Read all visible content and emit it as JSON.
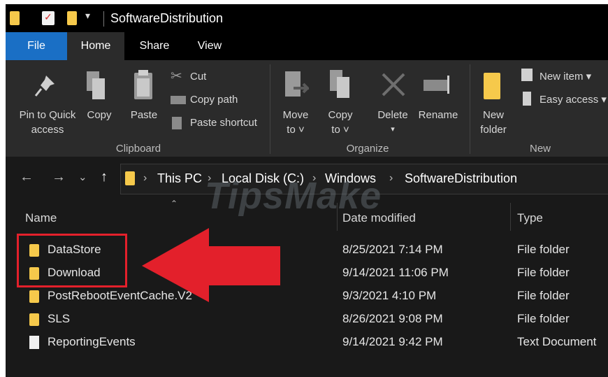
{
  "window": {
    "title": "SoftwareDistribution"
  },
  "tabs": [
    "File",
    "Home",
    "Share",
    "View"
  ],
  "ribbon": {
    "clipboard": {
      "pin_line1": "Pin to Quick",
      "pin_line2": "access",
      "copy": "Copy",
      "paste": "Paste",
      "cut": "Cut",
      "copy_path": "Copy path",
      "paste_shortcut": "Paste shortcut",
      "group": "Clipboard"
    },
    "organize": {
      "move_line1": "Move",
      "move_line2": "to ˅",
      "copy_line1": "Copy",
      "copy_line2": "to ˅",
      "delete": "Delete",
      "rename": "Rename",
      "group": "Organize"
    },
    "new": {
      "new_line1": "New",
      "new_line2": "folder",
      "new_item": "New item ▾",
      "easy_access": "Easy access ▾",
      "group": "New"
    }
  },
  "address": {
    "crumbs": [
      "This PC",
      "Local Disk (C:)",
      "Windows",
      "SoftwareDistribution"
    ]
  },
  "list": {
    "columns": [
      "Name",
      "Date modified",
      "Type"
    ],
    "rows": [
      {
        "name": "DataStore",
        "date": "8/25/2021 7:14 PM",
        "type": "File folder",
        "icon": "folder-icon"
      },
      {
        "name": "Download",
        "date": "9/14/2021 11:06 PM",
        "type": "File folder",
        "icon": "folder-icon"
      },
      {
        "name": "PostRebootEventCache.V2",
        "date": "9/3/2021 4:10 PM",
        "type": "File folder",
        "icon": "folder-icon"
      },
      {
        "name": "SLS",
        "date": "8/26/2021 9:08 PM",
        "type": "File folder",
        "icon": "folder-icon"
      },
      {
        "name": "ReportingEvents",
        "date": "9/14/2021 9:42 PM",
        "type": "Text Document",
        "icon": "document-icon"
      }
    ]
  },
  "watermark": "TipsMake",
  "colors": {
    "accent": "#1a6fc5",
    "highlight": "#e3202b",
    "folder": "#f6c94b"
  }
}
